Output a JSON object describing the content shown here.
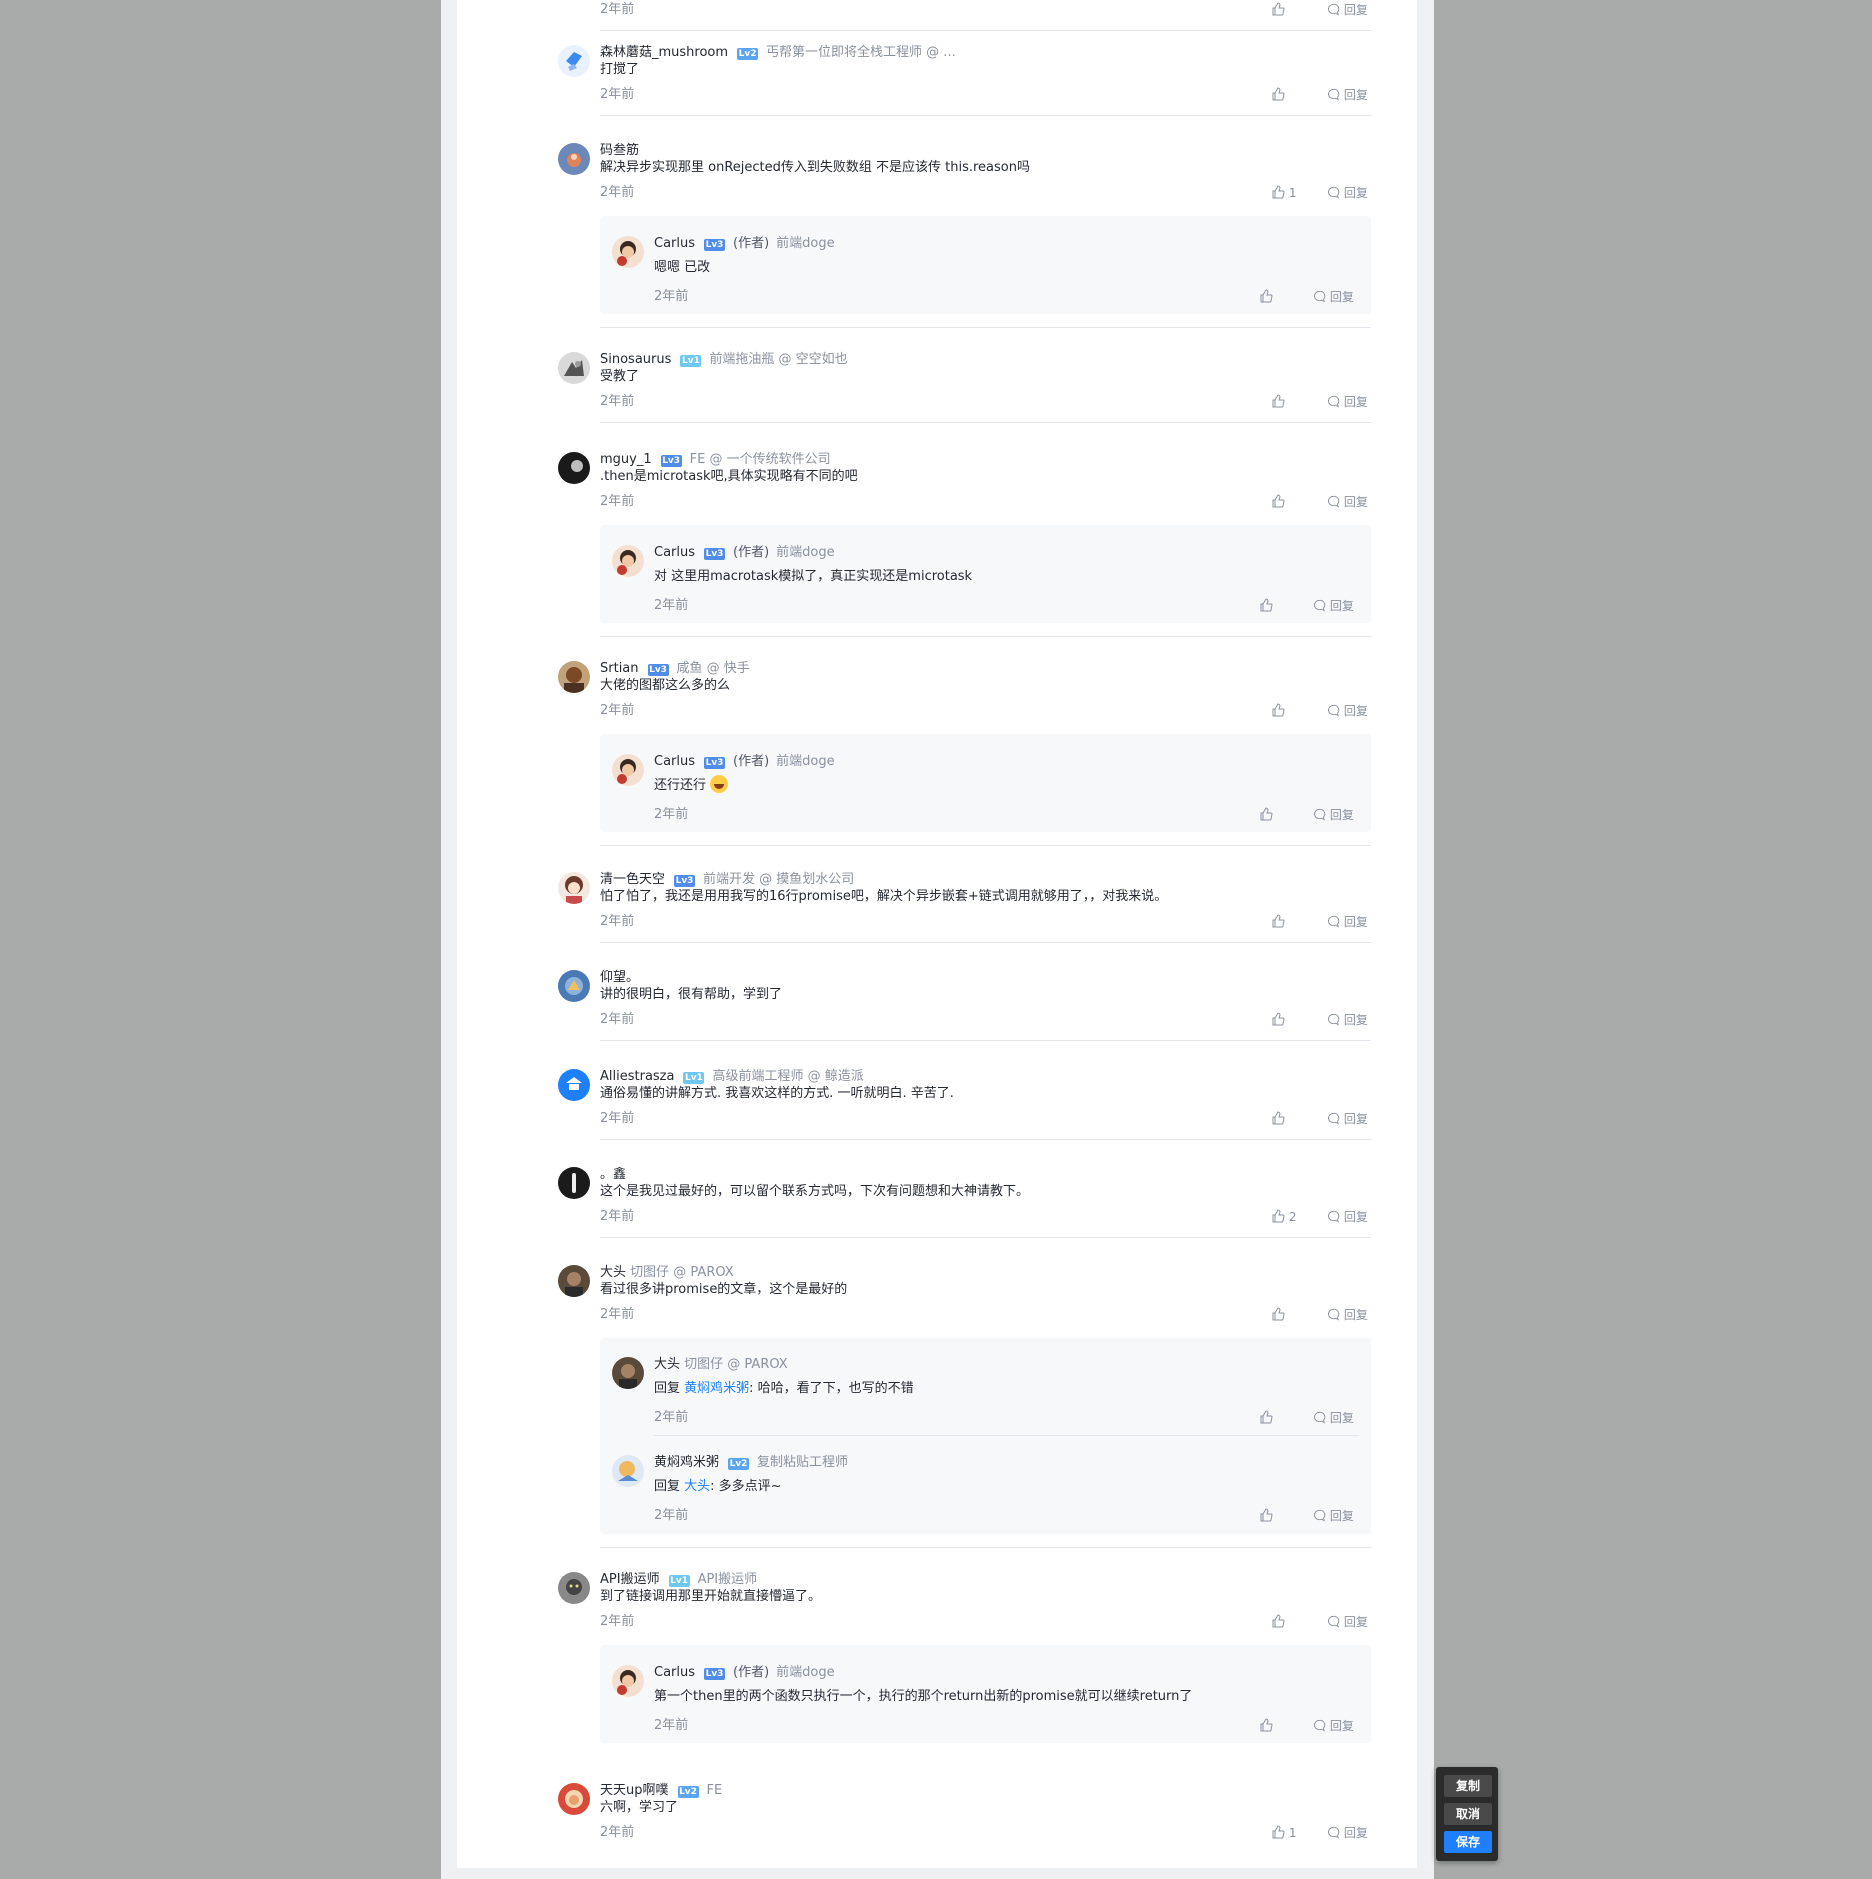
{
  "common": {
    "time": "2年前",
    "reply": "回复",
    "reply_prefix": "回复 ",
    "author_tag": "(作者)"
  },
  "toolbox": {
    "copy": "复制",
    "cancel": "取消",
    "save": "保存"
  },
  "comments": [
    {
      "text": ""
    },
    {
      "name": "森林蘑菇_mushroom",
      "level": "Lv2",
      "job": "丐帮第一位即将全栈工程师 @ ...",
      "text": "打搅了"
    },
    {
      "name": "码叁筋",
      "text": "解决异步实现那里 onRejected传入到失败数组 不是应该传 this.reason吗",
      "likes": "1",
      "replies": [
        {
          "name": "Carlus",
          "level": "Lv3",
          "job": "前端doge",
          "text": "嗯嗯 已改"
        }
      ]
    },
    {
      "name": "Sinosaurus",
      "level": "Lv1",
      "job": "前端拖油瓶 @ 空空如也",
      "text": "受教了"
    },
    {
      "name": "mguy_1",
      "level": "Lv3",
      "job": "FE @ 一个传统软件公司",
      "text": ".then是microtask吧,具体实现略有不同的吧",
      "replies": [
        {
          "name": "Carlus",
          "level": "Lv3",
          "job": "前端doge",
          "text": "对 这里用macrotask模拟了，真正实现还是microtask"
        }
      ]
    },
    {
      "name": "Srtian",
      "level": "Lv3",
      "job": "咸鱼 @ 快手",
      "text": "大佬的图都这么多的么",
      "replies": [
        {
          "name": "Carlus",
          "level": "Lv3",
          "job": "前端doge",
          "text": "还行还行"
        }
      ]
    },
    {
      "name": "清一色天空",
      "level": "Lv3",
      "job": "前端开发 @ 摸鱼划水公司",
      "text": "怕了怕了，我还是用用我写的16行promise吧，解决个异步嵌套+链式调用就够用了，，对我来说。"
    },
    {
      "name": "仰望。",
      "text": "讲的很明白，很有帮助，学到了"
    },
    {
      "name": "Alliestrasza",
      "level": "Lv1",
      "job": "高级前端工程师 @ 鲸造派",
      "text": "通俗易懂的讲解方式. 我喜欢这样的方式. 一听就明白. 辛苦了."
    },
    {
      "name": "。鑫",
      "text": "这个是我见过最好的，可以留个联系方式吗，下次有问题想和大神请教下。",
      "likes": "2"
    },
    {
      "name": "大头",
      "job": "切图仔 @ PAROX",
      "text": "看过很多讲promise的文章，这个是最好的",
      "replies": [
        {
          "name": "大头",
          "job": "切图仔 @ PAROX",
          "reply_to": "黄焖鸡米粥",
          "text": ": 哈哈，看了下，也写的不错"
        },
        {
          "name": "黄焖鸡米粥",
          "level": "Lv2",
          "job": "复制粘贴工程师",
          "reply_to": "大头",
          "text": ": 多多点评~"
        }
      ]
    },
    {
      "name": "API搬运师",
      "level": "Lv1",
      "job": "API搬运师",
      "text": "到了链接调用那里开始就直接懵逼了。",
      "replies": [
        {
          "name": "Carlus",
          "level": "Lv3",
          "job": "前端doge",
          "text": "第一个then里的两个函数只执行一个，执行的那个return出新的promise就可以继续return了"
        }
      ]
    },
    {
      "name": "天天up啊噗",
      "level": "Lv2",
      "job": "FE",
      "text": "六啊，学习了",
      "likes": "1"
    }
  ],
  "colors": {
    "accent": "#1e80ff",
    "secondary": "#8a919f",
    "text": "#252933",
    "sub_bg": "#f7f8fa"
  }
}
